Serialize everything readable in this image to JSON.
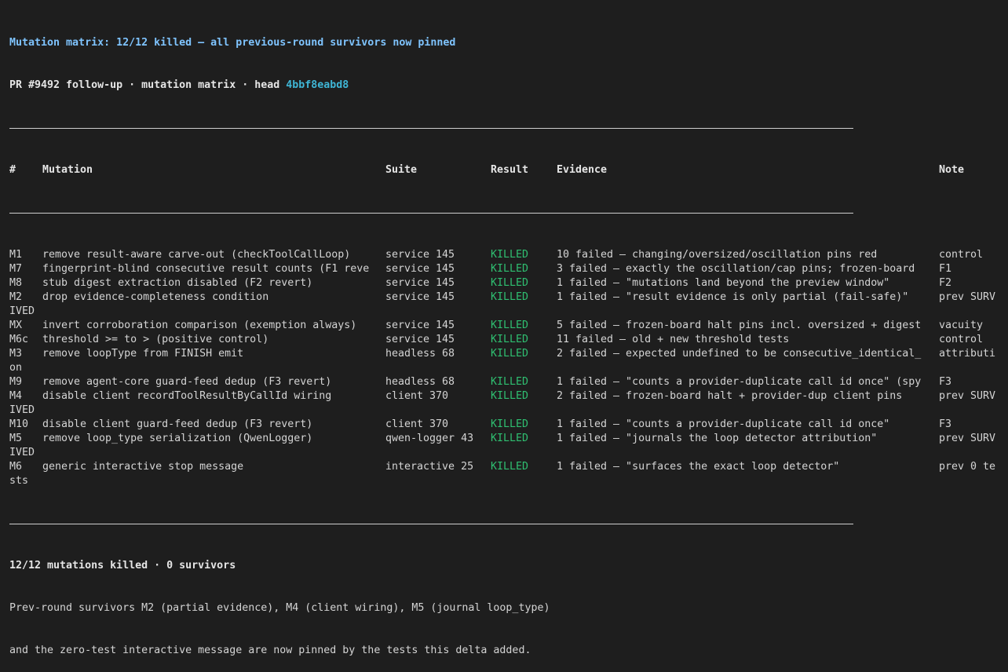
{
  "header": {
    "title": "Mutation matrix: 12/12 killed — all previous-round survivors now pinned",
    "subtitle_prefix": "PR #9492 follow-up · mutation matrix · head ",
    "head_hash": "4bbf8eabd8"
  },
  "table": {
    "columns": [
      "#",
      "Mutation",
      "Suite",
      "Result",
      "Evidence",
      "Note"
    ],
    "rows": [
      {
        "id": "M1",
        "mutation": "remove result-aware carve-out (checkToolCallLoop)",
        "suite": "service 145",
        "result": "KILLED",
        "evidence": "10 failed — changing/oversized/oscillation pins red",
        "note": "control"
      },
      {
        "id": "M7",
        "mutation": "fingerprint-blind consecutive result counts (F1 reve",
        "suite": "service 145",
        "result": "KILLED",
        "evidence": "3 failed — exactly the oscillation/cap pins; frozen-board",
        "note": "F1"
      },
      {
        "id": "M8",
        "mutation": "stub digest extraction disabled (F2 revert)",
        "suite": "service 145",
        "result": "KILLED",
        "evidence": "1 failed — \"mutations land beyond the preview window\"",
        "note": "F2"
      },
      {
        "id": "M2",
        "mutation": "drop evidence-completeness condition",
        "suite": "service 145",
        "result": "KILLED",
        "evidence": "1 failed — \"result evidence is only partial (fail-safe)\"",
        "note": "prev SURV",
        "wrap": "IVED"
      },
      {
        "id": "MX",
        "mutation": "invert corroboration comparison (exemption always)",
        "suite": "service 145",
        "result": "KILLED",
        "evidence": "5 failed — frozen-board halt pins incl. oversized + digest",
        "note": "vacuity"
      },
      {
        "id": "M6c",
        "mutation": "threshold >= to > (positive control)",
        "suite": "service 145",
        "result": "KILLED",
        "evidence": "11 failed — old + new threshold tests",
        "note": "control"
      },
      {
        "id": "M3",
        "mutation": "remove loopType from FINISH emit",
        "suite": "headless 68",
        "result": "KILLED",
        "evidence": "2 failed — expected undefined to be consecutive_identical_",
        "note": "attributi",
        "wrap": "on"
      },
      {
        "id": "M9",
        "mutation": "remove agent-core guard-feed dedup (F3 revert)",
        "suite": "headless 68",
        "result": "KILLED",
        "evidence": "1 failed — \"counts a provider-duplicate call id once\" (spy",
        "note": "F3"
      },
      {
        "id": "M4",
        "mutation": "disable client recordToolResultByCallId wiring",
        "suite": "client 370",
        "result": "KILLED",
        "evidence": "2 failed — frozen-board halt + provider-dup client pins",
        "note": "prev SURV",
        "wrap": "IVED"
      },
      {
        "id": "M10",
        "mutation": "disable client guard-feed dedup (F3 revert)",
        "suite": "client 370",
        "result": "KILLED",
        "evidence": "1 failed — \"counts a provider-duplicate call id once\"",
        "note": "F3"
      },
      {
        "id": "M5",
        "mutation": "remove loop_type serialization (QwenLogger)",
        "suite": "qwen-logger 43",
        "result": "KILLED",
        "evidence": "1 failed — \"journals the loop detector attribution\"",
        "note": "prev SURV",
        "wrap": "IVED"
      },
      {
        "id": "M6",
        "mutation": "generic interactive stop message",
        "suite": "interactive 25",
        "result": "KILLED",
        "evidence": "1 failed — \"surfaces the exact loop detector\"",
        "note": "prev 0 te",
        "wrap": "sts"
      }
    ]
  },
  "summary": {
    "title": "12/12 mutations killed · 0 survivors",
    "line1": "Prev-round survivors M2 (partial evidence), M4 (client wiring), M5 (journal loop_type)",
    "line2": "and the zero-test interactive message are now pinned by the tests this delta added."
  },
  "colors": {
    "background": "#1e1e1e",
    "title": "#7fc4ff",
    "hash": "#3fb6d6",
    "killed": "#2fbf71",
    "text": "#d4d4d4"
  }
}
